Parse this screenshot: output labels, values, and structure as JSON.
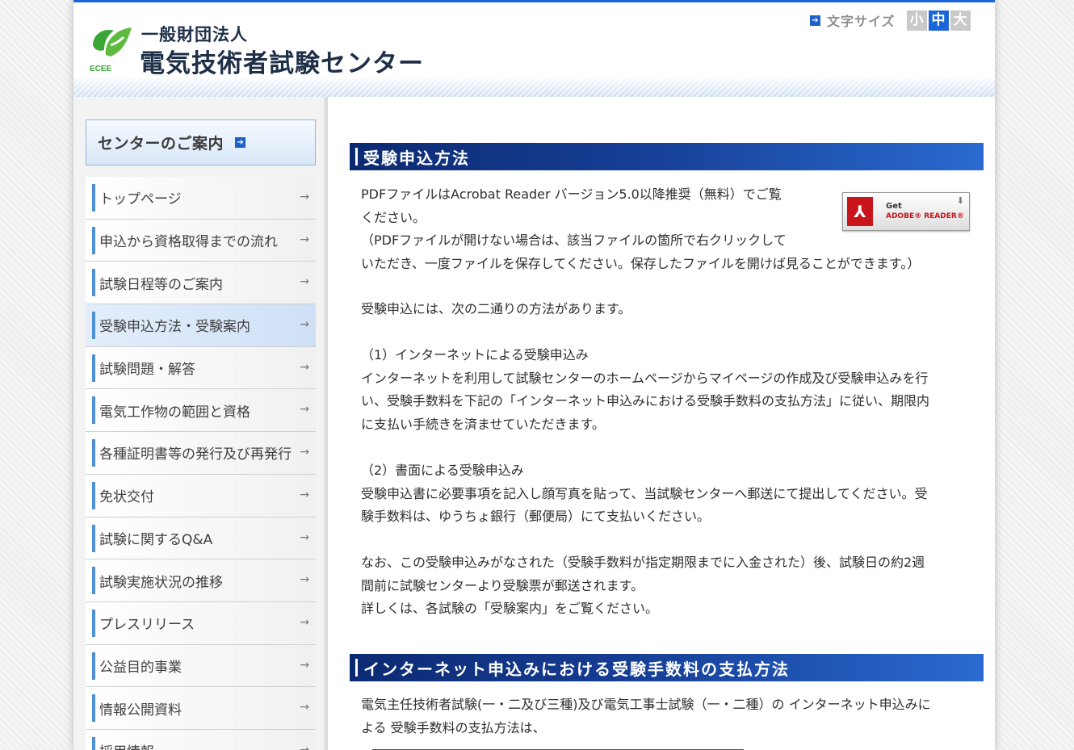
{
  "header": {
    "org_type": "一般財団法人",
    "org_name": "電気技術者試験センター",
    "logo_text": "ECEE",
    "font_size": {
      "label": "文字サイズ",
      "options": [
        "小",
        "中",
        "大"
      ],
      "selected": "中"
    }
  },
  "sidebar": {
    "guide_label": "センターのご案内",
    "items": [
      {
        "label": "トップページ"
      },
      {
        "label": "申込から資格取得までの流れ"
      },
      {
        "label": "試験日程等のご案内"
      },
      {
        "label": "受験申込方法・受験案内",
        "active": true
      },
      {
        "label": "試験問題・解答"
      },
      {
        "label": "電気工作物の範囲と資格"
      },
      {
        "label": "各種証明書等の発行及び再発行"
      },
      {
        "label": "免状交付"
      },
      {
        "label": "試験に関するQ&A"
      },
      {
        "label": "試験実施状況の推移"
      },
      {
        "label": "プレスリリース"
      },
      {
        "label": "公益目的事業"
      },
      {
        "label": "情報公開資料"
      },
      {
        "label": "採用情報"
      }
    ]
  },
  "main": {
    "section1_title": "受験申込方法",
    "adobe": {
      "get": "Get",
      "reader": "ADOBE® READER®"
    },
    "p1_line1": "PDFファイルはAcrobat Reader バージョン5.0以降推奨（無料）でご覧",
    "p1_line2": "ください。",
    "p1_line3": "（PDFファイルが開けない場合は、該当ファイルの箇所で右クリックして",
    "p1_line4": "いただき、一度ファイルを保存してください。保存したファイルを開けば見ることができます。）",
    "p2": "受験申込には、次の二通りの方法があります。",
    "m1_title": "（1）インターネットによる受験申込み",
    "m1_line1": "インターネットを利用して試験センターのホームページからマイページの作成及び受験申込みを行",
    "m1_line2": "い、受験手数料を下記の「インターネット申込みにおける受験手数料の支払方法」に従い、期限内",
    "m1_line3": "に支払い手続きを済ませていただきます。",
    "m2_title": "（2）書面による受験申込み",
    "m2_line1": "受験申込書に必要事項を記入し顔写真を貼って、当試験センターへ郵送にて提出してください。受",
    "m2_line2": "験手数料は、ゆうちょ銀行（郵便局）にて支払いください。",
    "p3_line1": "なお、この受験申込みがなされた（受験手数料が指定期限までに入金された）後、試験日の約2週",
    "p3_line2": "間前に試験センターより受験票が郵送されます。",
    "p3_line3": "詳しくは、各試験の「受験案内」をご覧ください。",
    "section2_title": "インターネット申込みにおける受験手数料の支払方法",
    "s2_line1": "電気主任技術者試験(一・二及び三種)及び電気工事士試験（一・二種）の インターネット申込みに",
    "s2_line2": "よる 受験手数料の支払方法は、"
  }
}
